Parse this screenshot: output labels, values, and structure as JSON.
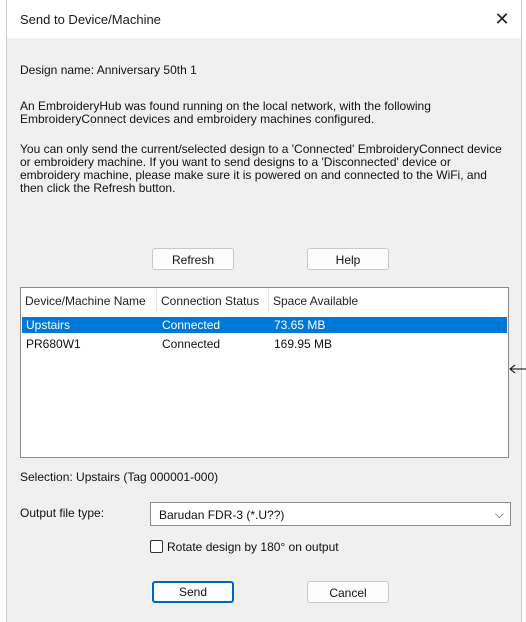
{
  "window": {
    "title": "Send to Device/Machine",
    "close_glyph": "✕"
  },
  "design_name": "Design name: Anniversary 50th 1",
  "paragraphs": [
    "An EmbroideryHub was found running on the local network, with the following",
    "EmbroideryConnect devices and embroidery machines configured.",
    "You can only send the current/selected design to a 'Connected' EmbroideryConnect device",
    "or embroidery machine. If you want to send designs to a 'Disconnected' device or",
    "embroidery machine, please make sure it is powered on and connected to the WiFi, and",
    "then click the Refresh button."
  ],
  "buttons": {
    "refresh": "Refresh",
    "help": "Help",
    "send": "Send",
    "cancel": "Cancel"
  },
  "table": {
    "headers": [
      "Device/Machine Name",
      "Connection Status",
      "Space Available"
    ],
    "rows": [
      {
        "name": "Upstairs",
        "status": "Connected",
        "space": "73.65 MB",
        "selected": true
      },
      {
        "name": "PR680W1",
        "status": "Connected",
        "space": "169.95 MB",
        "selected": false
      }
    ]
  },
  "selection": "Selection: Upstairs (Tag 000001-000)",
  "output": {
    "label": "Output file type:",
    "value": "Barudan FDR-3 (*.U??)",
    "chevron": "⌵"
  },
  "rotate": {
    "label": "Rotate design by 180° on output",
    "checked": false
  },
  "colors": {
    "selected_row": "#0078d7",
    "primary_border": "#0067c0"
  }
}
